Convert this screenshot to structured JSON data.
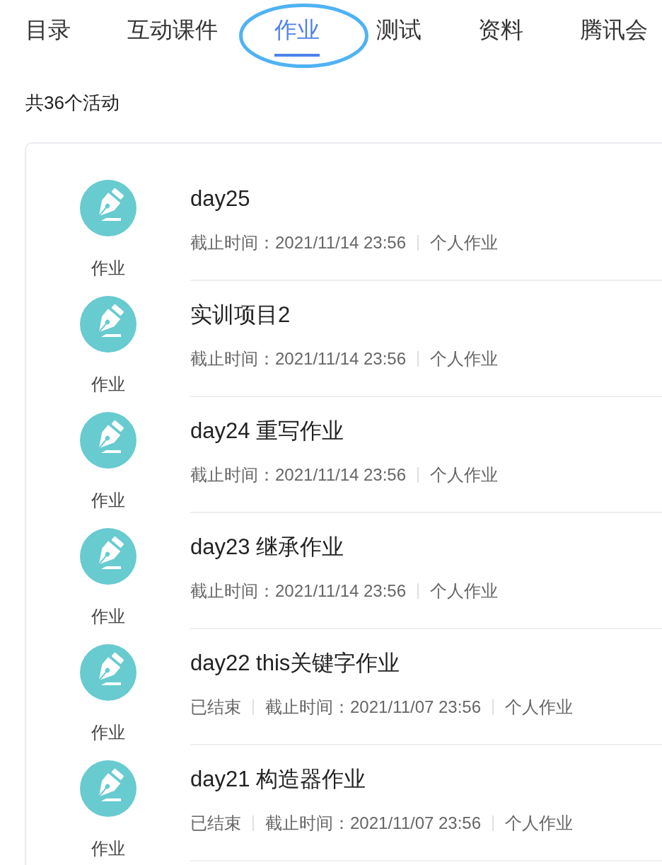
{
  "tabs": [
    {
      "label": "目录",
      "selected": false,
      "circled": false
    },
    {
      "label": "互动课件",
      "selected": false,
      "circled": false
    },
    {
      "label": "作业",
      "selected": true,
      "circled": true
    },
    {
      "label": "测试",
      "selected": false,
      "circled": false
    },
    {
      "label": "资料",
      "selected": false,
      "circled": false
    },
    {
      "label": "腾讯会",
      "selected": false,
      "circled": false
    }
  ],
  "summary": "共36个活动",
  "activities": [
    {
      "icon_label": "作业",
      "title": "day25",
      "deadline": "截止时间：2021/11/14 23:56",
      "type": "个人作业"
    },
    {
      "icon_label": "作业",
      "title": "实训项目2",
      "deadline": "截止时间：2021/11/14 23:56",
      "type": "个人作业"
    },
    {
      "icon_label": "作业",
      "title": "day24 重写作业",
      "deadline": "截止时间：2021/11/14 23:56",
      "type": "个人作业"
    },
    {
      "icon_label": "作业",
      "title": "day23 继承作业",
      "deadline": "截止时间：2021/11/14 23:56",
      "type": "个人作业"
    },
    {
      "icon_label": "作业",
      "title": "day22 this关键字作业",
      "status": "已结束",
      "deadline": "截止时间：2021/11/07 23:56",
      "type": "个人作业"
    },
    {
      "icon_label": "作业",
      "title": "day21 构造器作业",
      "status": "已结束",
      "deadline": "截止时间：2021/11/07 23:56",
      "type": "个人作业"
    }
  ]
}
